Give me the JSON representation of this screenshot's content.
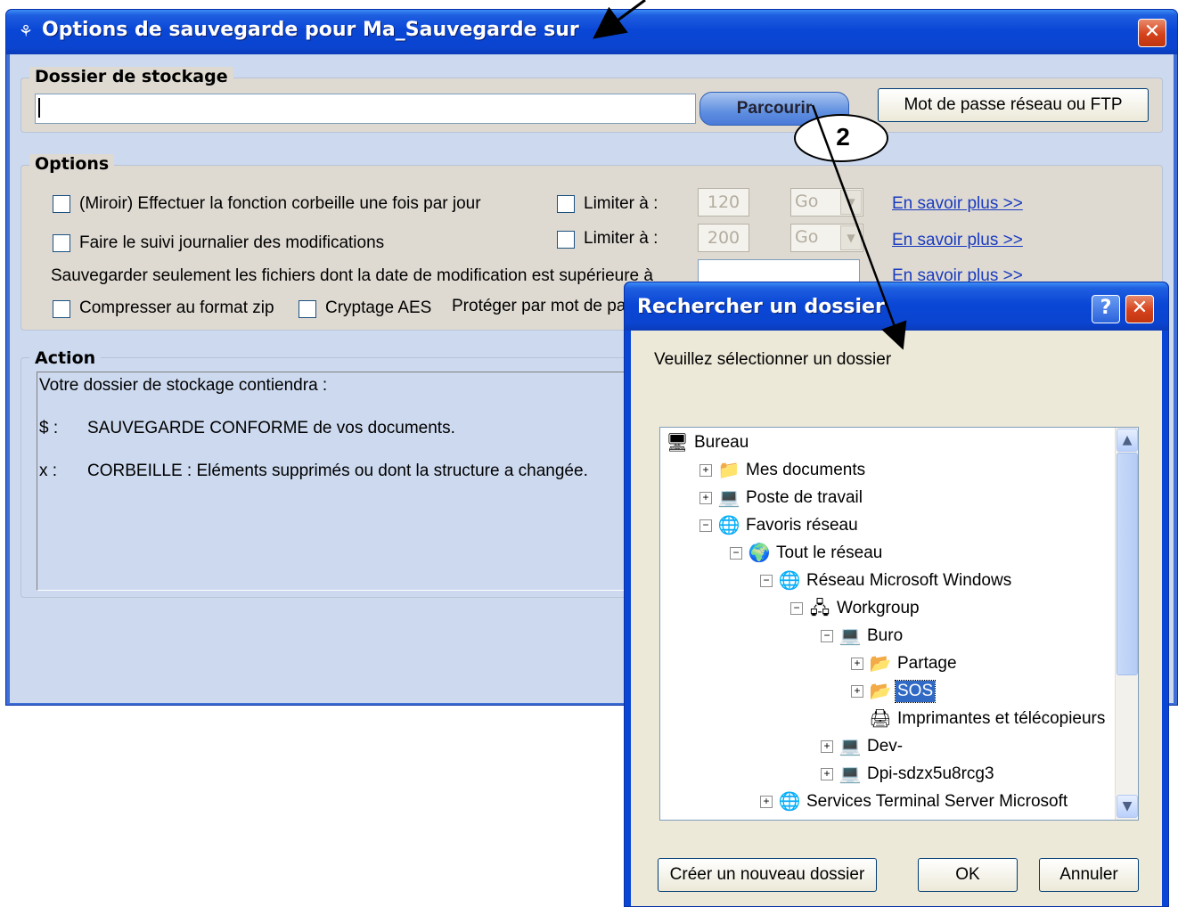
{
  "main_window": {
    "title": "Options de sauvegarde pour Ma_Sauvegarde  sur",
    "close_glyph": "✕",
    "icon": "app-icon"
  },
  "storage": {
    "group_label": "Dossier de stockage",
    "path_value": "",
    "browse_button": "Parcourir",
    "network_button": "Mot de passe réseau ou FTP"
  },
  "options": {
    "group_label": "Options",
    "mirror_label": "(Miroir) Effectuer la fonction corbeille une fois par jour",
    "journal_label": "Faire le suivi journalier des modifications",
    "limit1_label": "Limiter à :",
    "limit1_value": "120",
    "limit1_unit": "Go",
    "limit2_label": "Limiter à :",
    "limit2_value": "200",
    "limit2_unit": "Go",
    "date_label": "Sauvegarder seulement les fichiers dont la date de modification est supérieure à",
    "learn_more": "En savoir plus >>",
    "zip_label": "Compresser au format zip",
    "aes_label": "Cryptage AES",
    "password_label": "Protéger par mot de pa"
  },
  "action": {
    "group_label": "Action",
    "line1": "Votre dossier de stockage  contiendra :",
    "line2_key": "$ :",
    "line2_text": "SAUVEGARDE CONFORME de vos documents.",
    "line3_key": "x :",
    "line3_text": "CORBEILLE : Eléments supprimés ou dont la structure a changée."
  },
  "dialog": {
    "title": "Rechercher un dossier",
    "help_glyph": "?",
    "close_glyph": "✕",
    "prompt": "Veuillez sélectionner un dossier",
    "tree": [
      {
        "label": "Bureau",
        "icon": "desktop-icon",
        "glyph": "🖥"
      },
      {
        "label": "Mes documents",
        "icon": "documents-folder-icon",
        "glyph": "📁"
      },
      {
        "label": "Poste de travail",
        "icon": "computer-icon",
        "glyph": "💻"
      },
      {
        "label": "Favoris réseau",
        "icon": "network-places-icon",
        "glyph": "🌐"
      },
      {
        "label": "Tout le réseau",
        "icon": "globe-icon",
        "glyph": "🌍"
      },
      {
        "label": "Réseau Microsoft Windows",
        "icon": "windows-network-icon",
        "glyph": "🌐"
      },
      {
        "label": "Workgroup",
        "icon": "workgroup-icon",
        "glyph": "🖧"
      },
      {
        "label": "Buro",
        "icon": "computer-icon",
        "glyph": "💻"
      },
      {
        "label": "Partage",
        "icon": "shared-folder-icon",
        "glyph": "📂"
      },
      {
        "label": "SOS",
        "icon": "shared-folder-icon",
        "glyph": "📂"
      },
      {
        "label": "Imprimantes et télécopieurs",
        "icon": "printer-icon",
        "glyph": "🖨"
      },
      {
        "label": "Dev-",
        "icon": "computer-icon",
        "glyph": "💻"
      },
      {
        "label": "Dpi-sdzx5u8rcg3",
        "icon": "computer-icon",
        "glyph": "💻"
      },
      {
        "label": "Services Terminal Server Microsoft",
        "icon": "terminal-server-icon",
        "glyph": "🌐"
      }
    ],
    "new_folder_button": "Créer un nouveau dossier",
    "ok_button": "OK",
    "cancel_button": "Annuler"
  },
  "annotation": {
    "callout_number": "2"
  },
  "colors": {
    "title_bar": "#0a47d6",
    "close_red": "#d5421c",
    "client_blue": "#ccd9ef",
    "group_beige": "#dedad2",
    "selection": "#316ac5",
    "link": "#1a3bbf"
  }
}
